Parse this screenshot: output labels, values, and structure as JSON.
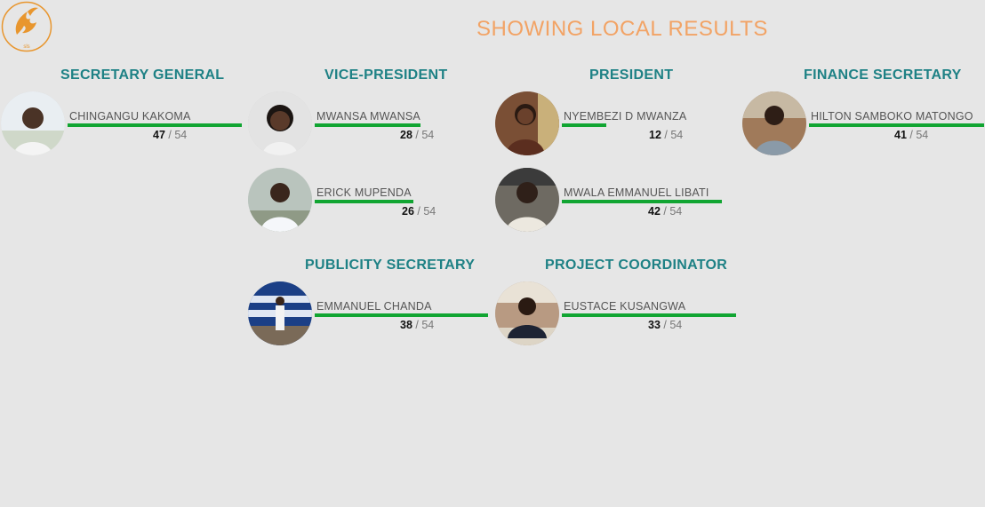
{
  "header": {
    "title": "SHOWING LOCAL RESULTS",
    "logo_text": "sls",
    "logo_color": "#e8962e"
  },
  "colors": {
    "bar": "#11a532",
    "heading": "#1e8185",
    "title": "#f2a365"
  },
  "positions": [
    {
      "title": "SECRETARY GENERAL",
      "total": 54,
      "candidates": [
        {
          "name": "CHINGANGU KAKOMA",
          "votes": 47,
          "bar_share": 0.87,
          "photo_icon": "person-photo-icon"
        }
      ]
    },
    {
      "title": "VICE-PRESIDENT",
      "total": 54,
      "candidates": [
        {
          "name": "MWANSA MWANSA",
          "votes": 28,
          "bar_share": 0.52,
          "photo_icon": "person-photo-icon"
        },
        {
          "name": "ERICK MUPENDA",
          "votes": 26,
          "bar_share": 0.48,
          "photo_icon": "person-photo-icon"
        }
      ]
    },
    {
      "title": "PRESIDENT",
      "total": 54,
      "candidates": [
        {
          "name": "NYEMBEZI D MWANZA",
          "votes": 12,
          "bar_share": 0.22,
          "photo_icon": "person-photo-icon"
        },
        {
          "name": "MWALA EMMANUEL LIBATI",
          "votes": 42,
          "bar_share": 0.78,
          "photo_icon": "person-photo-icon"
        }
      ]
    },
    {
      "title": "FINANCE SECRETARY",
      "total": 54,
      "candidates": [
        {
          "name": "HILTON SAMBOKO MATONGO",
          "votes": 41,
          "bar_share": 0.9,
          "photo_icon": "person-photo-icon"
        }
      ]
    },
    {
      "title": "PUBLICITY SECRETARY",
      "total": 54,
      "candidates": [
        {
          "name": "EMMANUEL CHANDA",
          "votes": 38,
          "bar_share": 0.7,
          "photo_icon": "person-photo-icon"
        }
      ]
    },
    {
      "title": "PROJECT COORDINATOR",
      "total": 54,
      "candidates": [
        {
          "name": "EUSTACE KUSANGWA",
          "votes": 33,
          "bar_share": 0.62,
          "photo_icon": "person-photo-icon"
        }
      ]
    }
  ]
}
